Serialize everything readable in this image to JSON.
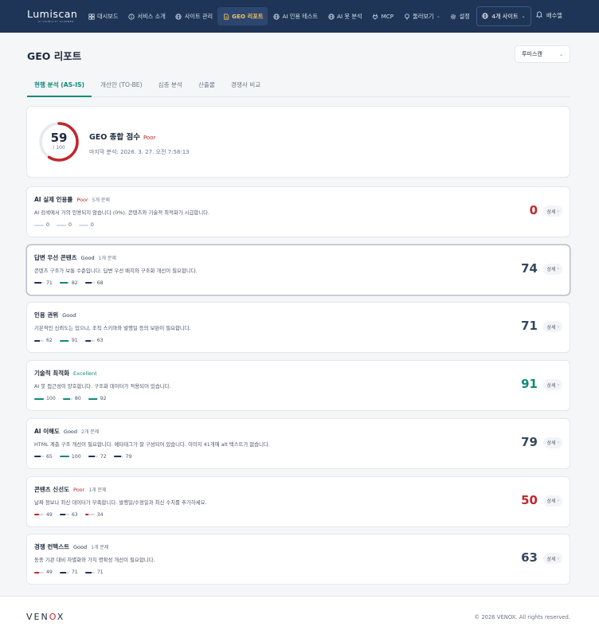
{
  "brand": {
    "name": "Lumiscan",
    "tagline": "AI VISIBILITY SCANNER"
  },
  "nav": {
    "items": [
      {
        "label": "대시보드",
        "icon": "grid-icon"
      },
      {
        "label": "서비스 소개",
        "icon": "info-icon"
      },
      {
        "label": "사이트 관리",
        "icon": "globe-icon"
      },
      {
        "label": "GEO 리포트",
        "icon": "document-icon",
        "active": true
      },
      {
        "label": "AI 인용 테스트",
        "icon": "globe-icon"
      },
      {
        "label": "AI 봇 분석",
        "icon": "globe-icon"
      },
      {
        "label": "MCP",
        "icon": "plug-icon"
      },
      {
        "label": "둘러보기",
        "icon": "lightbulb-icon",
        "dropdown": true
      },
      {
        "label": "설정",
        "icon": "gear-icon"
      }
    ],
    "site_button": "4개 사이트",
    "user_name": "배수엘"
  },
  "page": {
    "title": "GEO 리포트",
    "site_select": "루미스캔"
  },
  "tabs": [
    "현행 분석 (AS-IS)",
    "개선안 (TO-BE)",
    "심층 분석",
    "산출물",
    "경쟁사 비교"
  ],
  "overall": {
    "score": "59",
    "score_value": 59,
    "max": "/ 100",
    "title": "GEO 종합 점수",
    "status": "Poor",
    "date": "마지막 분석: 2026. 3. 27. 오전 7:58:13"
  },
  "detail_label": "상세",
  "metrics": [
    {
      "title": "AI 실제 인용률",
      "status": "Poor",
      "status_class": "poor",
      "issues": "5개 문제",
      "desc": "AI 검색에서 거의 인용되지 않습니다 (0%). 콘텐츠와 기술적 최적화가 시급합니다.",
      "score": "0",
      "score_color": "#c1272d",
      "bars": [
        {
          "value": "0",
          "fill": 0,
          "color": "#d6dbe2"
        },
        {
          "value": "0",
          "fill": 0,
          "color": "#d6dbe2"
        },
        {
          "value": "0",
          "fill": 0,
          "color": "#d6dbe2"
        }
      ]
    },
    {
      "title": "답변 우선 콘텐츠",
      "status": "Good",
      "status_class": "good",
      "issues": "1개 문제",
      "desc": "콘텐츠 구조가 보통 수준입니다. 답변 우선 배치와 구조화 개선이 필요합니다.",
      "score": "74",
      "score_color": "#34495e",
      "highlight": true,
      "bars": [
        {
          "value": "71",
          "fill": 71,
          "color": "#1e3557"
        },
        {
          "value": "82",
          "fill": 82,
          "color": "#0f8a7a"
        },
        {
          "value": "68",
          "fill": 68,
          "color": "#1e3557"
        }
      ]
    },
    {
      "title": "인용 권위",
      "status": "Good",
      "status_class": "good",
      "issues": "",
      "desc": "기본적인 신뢰도는 있으나, 조직 스키마와 발행일 등의 보완이 필요합니다.",
      "score": "71",
      "score_color": "#34495e",
      "bars": [
        {
          "value": "62",
          "fill": 62,
          "color": "#1e3557"
        },
        {
          "value": "91",
          "fill": 91,
          "color": "#0f8a7a"
        },
        {
          "value": "63",
          "fill": 63,
          "color": "#1e3557"
        }
      ]
    },
    {
      "title": "기술적 최적화",
      "status": "Excellent",
      "status_class": "excellent",
      "issues": "",
      "desc": "AI 봇 접근성이 양호합니다. 구조화 데이터가 적용되어 있습니다.",
      "score": "91",
      "score_color": "#0f8a7a",
      "bars": [
        {
          "value": "100",
          "fill": 100,
          "color": "#0f8a7a"
        },
        {
          "value": "80",
          "fill": 80,
          "color": "#0f8a7a"
        },
        {
          "value": "92",
          "fill": 92,
          "color": "#0f8a7a"
        }
      ]
    },
    {
      "title": "AI 이해도",
      "status": "Good",
      "status_class": "good",
      "issues": "2개 문제",
      "desc": "HTML 계층 구조 개선이 필요합니다. 메타태그가 잘 구성되어 있습니다. 이미지 41개에 alt 텍스트가 없습니다.",
      "score": "79",
      "score_color": "#34495e",
      "bars": [
        {
          "value": "65",
          "fill": 65,
          "color": "#1e3557"
        },
        {
          "value": "100",
          "fill": 100,
          "color": "#0f8a7a"
        },
        {
          "value": "72",
          "fill": 72,
          "color": "#1e3557"
        },
        {
          "value": "79",
          "fill": 79,
          "color": "#1e3557"
        }
      ]
    },
    {
      "title": "콘텐츠 신선도",
      "status": "Poor",
      "status_class": "poor",
      "issues": "1개 문제",
      "desc": "날짜 정보나 최신 데이터가 부족합니다. 발행일/수정일과 최신 수치를 추가하세요.",
      "score": "50",
      "score_color": "#c1272d",
      "bars": [
        {
          "value": "49",
          "fill": 49,
          "color": "#c1272d"
        },
        {
          "value": "63",
          "fill": 63,
          "color": "#1e3557"
        },
        {
          "value": "34",
          "fill": 34,
          "color": "#c1272d"
        }
      ]
    },
    {
      "title": "경쟁 컨텍스트",
      "status": "Good",
      "status_class": "good",
      "issues": "1개 문제",
      "desc": "동종 기관 대비 차별화와 가치 명확성 개선이 필요합니다.",
      "score": "63",
      "score_color": "#34495e",
      "bars": [
        {
          "value": "49",
          "fill": 49,
          "color": "#c1272d"
        },
        {
          "value": "71",
          "fill": 71,
          "color": "#1e3557"
        },
        {
          "value": "71",
          "fill": 71,
          "color": "#1e3557"
        }
      ]
    }
  ],
  "footer": {
    "logo_pre": "VEN",
    "logo_o": "O",
    "logo_post": "X",
    "copyright": "© 2026 VENOX. All rights reserved."
  },
  "colors": {
    "nav_bg": "#1e3557",
    "accent": "#0f8a7a",
    "active_nav": "#f2c35b",
    "poor": "#c1272d"
  }
}
